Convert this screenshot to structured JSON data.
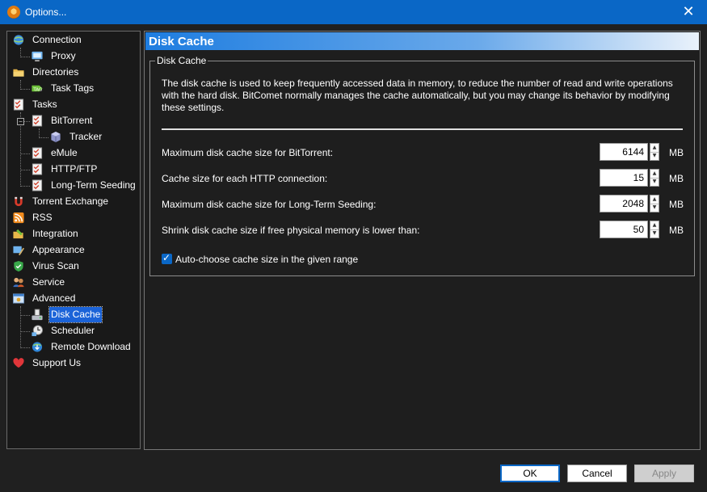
{
  "window": {
    "title": "Options...",
    "close_glyph": "✕"
  },
  "tree": {
    "items": [
      {
        "label": "Connection",
        "icon": "connection-globe-icon"
      },
      {
        "label": "Proxy",
        "icon": "proxy-icon"
      },
      {
        "label": "Directories",
        "icon": "folder-icon"
      },
      {
        "label": "Task Tags",
        "icon": "tag-icon"
      },
      {
        "label": "Tasks",
        "icon": "tasks-checklist-icon"
      },
      {
        "label": "BitTorrent",
        "icon": "bittorrent-checklist-icon"
      },
      {
        "label": "Tracker",
        "icon": "tracker-cube-icon"
      },
      {
        "label": "eMule",
        "icon": "emule-checklist-icon"
      },
      {
        "label": "HTTP/FTP",
        "icon": "http-ftp-checklist-icon"
      },
      {
        "label": "Long-Term Seeding",
        "icon": "seeding-checklist-icon"
      },
      {
        "label": "Torrent Exchange",
        "icon": "magnet-icon"
      },
      {
        "label": "RSS",
        "icon": "rss-icon"
      },
      {
        "label": "Integration",
        "icon": "integration-icon"
      },
      {
        "label": "Appearance",
        "icon": "appearance-icon"
      },
      {
        "label": "Virus Scan",
        "icon": "shield-icon"
      },
      {
        "label": "Service",
        "icon": "service-icon"
      },
      {
        "label": "Advanced",
        "icon": "advanced-icon"
      },
      {
        "label": "Disk Cache",
        "icon": "disk-cache-icon"
      },
      {
        "label": "Scheduler",
        "icon": "scheduler-icon"
      },
      {
        "label": "Remote Download",
        "icon": "remote-download-icon"
      },
      {
        "label": "Support Us",
        "icon": "heart-icon"
      }
    ],
    "selected": "Disk Cache"
  },
  "panel": {
    "title": "Disk Cache",
    "group_label": "Disk Cache",
    "description": "The disk cache is used to keep frequently accessed data in memory, to reduce the number of read and write operations with the hard disk. BitComet normally manages the cache automatically, but you may change its behavior by modifying these settings.",
    "settings": [
      {
        "label": "Maximum disk cache size for BitTorrent:",
        "value": "6144",
        "unit": "MB"
      },
      {
        "label": "Cache size for each HTTP connection:",
        "value": "15",
        "unit": "MB"
      },
      {
        "label": "Maximum disk cache size for Long-Term Seeding:",
        "value": "2048",
        "unit": "MB"
      },
      {
        "label": "Shrink disk cache size if free physical memory is lower than:",
        "value": "50",
        "unit": "MB"
      }
    ],
    "auto_choose": {
      "label": "Auto-choose cache size in the given range",
      "checked": true
    }
  },
  "buttons": {
    "ok": "OK",
    "cancel": "Cancel",
    "apply": "Apply"
  },
  "colors": {
    "titlebar": "#0a67c6",
    "selection": "#1b63d8",
    "header_gradient_start": "#1e7de0"
  }
}
